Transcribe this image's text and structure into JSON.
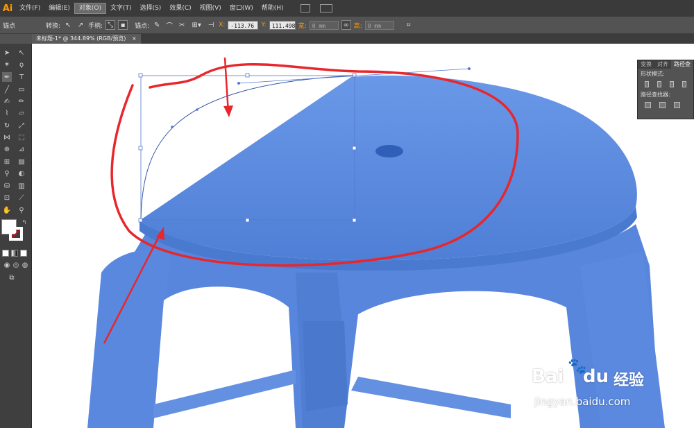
{
  "app": {
    "logo": "Ai"
  },
  "menu": {
    "items": [
      "文件(F)",
      "编辑(E)",
      "对象(O)",
      "文字(T)",
      "选择(S)",
      "效果(C)",
      "视图(V)",
      "窗口(W)",
      "帮助(H)"
    ],
    "active_index": 2
  },
  "control_bar": {
    "selection_label": "锚点",
    "convert_label": "转换:",
    "handles_label": "手柄:",
    "anchor_label": "锚点:",
    "x_label": "X:",
    "x_value": "-113.76",
    "y_label": "Y:",
    "y_value": "111.498",
    "width_label": "宽:",
    "width_value": "0 mm",
    "height_label": "高:",
    "height_value": "0 mm"
  },
  "document_tab": {
    "title": "未标题-1* @ 344.89% (RGB/预览)",
    "close": "×"
  },
  "panel": {
    "tabs": [
      "变换",
      "对齐",
      "路径查"
    ],
    "active_tab": 2,
    "shape_mode_label": "形状模式:",
    "pathfinder_label": "路径查找器:"
  },
  "watermark": {
    "brand": "Bai",
    "brand2": "du",
    "chinese": "经验",
    "url": "jingyan.baidu.com"
  },
  "colors": {
    "stool_blue": "#5b8be0",
    "annotation_red": "#e8262c",
    "accent_orange": "#ff9a00"
  }
}
